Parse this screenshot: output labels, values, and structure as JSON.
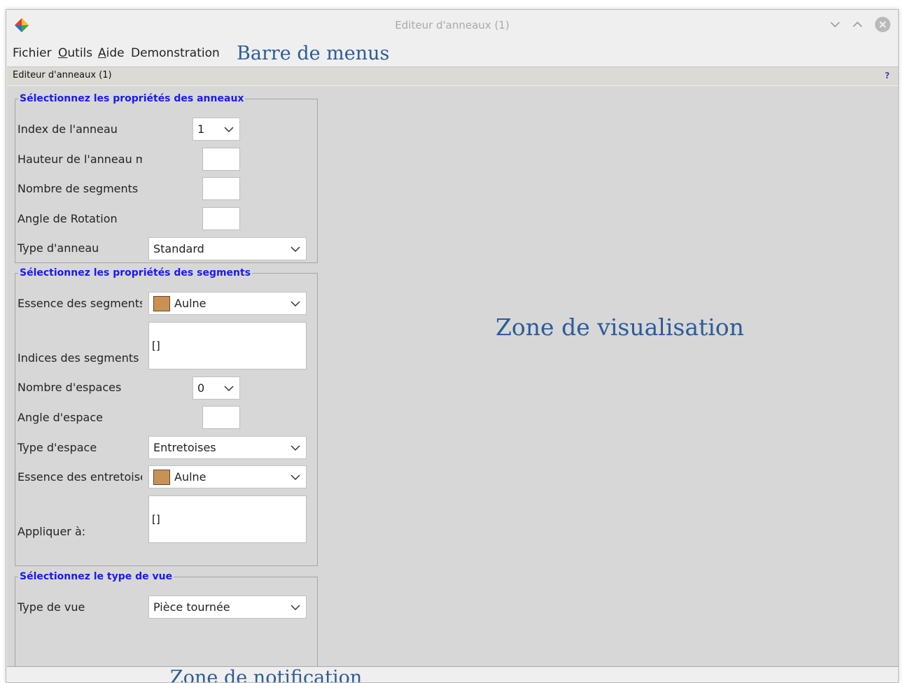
{
  "window": {
    "title": "Editeur d'anneaux (1)"
  },
  "menubar": {
    "fichier_label": "Fichier",
    "outils_mnemonic": "O",
    "outils_rest": "utils",
    "aide_mnemonic": "A",
    "aide_rest": "ide",
    "demonstration_label": "Demonstration"
  },
  "annotations": {
    "menubar": "Barre de menus",
    "visualisation": "Zone de visualisation",
    "notification": "Zone de notification"
  },
  "inner_panel": {
    "title": "Editeur d'anneaux (1)",
    "help_icon": "?"
  },
  "ring_properties": {
    "legend": "Sélectionnez les propriétés des anneaux",
    "index_label": "Index de l'anneau",
    "index_value": "1",
    "height_label": "Hauteur de l'anneau mm",
    "height_value": "",
    "segments_label": "Nombre de segments",
    "segments_value": "",
    "rotation_label": "Angle de Rotation",
    "rotation_value": "",
    "type_label": "Type d'anneau",
    "type_value": "Standard"
  },
  "segment_properties": {
    "legend": "Sélectionnez les propriétés des segments",
    "essence_label": "Essence des segments",
    "essence_value": "Aulne",
    "indices_label": "Indices des segments",
    "indices_value": "[]",
    "spaces_label": "Nombre d'espaces",
    "spaces_value": "0",
    "space_angle_label": "Angle d'espace",
    "space_angle_value": "",
    "space_type_label": "Type d'espace",
    "space_type_value": "Entretoises",
    "spacer_essence_label": "Essence des entretoises",
    "spacer_essence_value": "Aulne",
    "apply_label": "Appliquer à:",
    "apply_value": "[]"
  },
  "view_type": {
    "legend": "Sélectionnez le type de vue",
    "label": "Type de vue",
    "value": "Pièce tournée"
  },
  "colors": {
    "wood_swatch": "#c99154",
    "legend_text": "#1a1af0",
    "annotation_text": "#2c5c98"
  }
}
